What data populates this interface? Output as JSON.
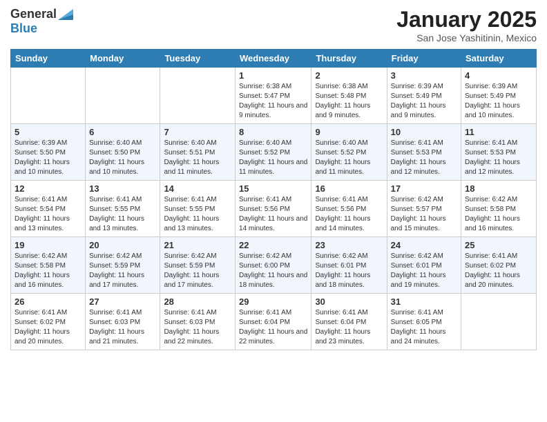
{
  "logo": {
    "line1": "General",
    "line2": "Blue"
  },
  "title": "January 2025",
  "subtitle": "San Jose Yashitinin, Mexico",
  "weekdays": [
    "Sunday",
    "Monday",
    "Tuesday",
    "Wednesday",
    "Thursday",
    "Friday",
    "Saturday"
  ],
  "weeks": [
    [
      {
        "day": "",
        "info": ""
      },
      {
        "day": "",
        "info": ""
      },
      {
        "day": "",
        "info": ""
      },
      {
        "day": "1",
        "info": "Sunrise: 6:38 AM\nSunset: 5:47 PM\nDaylight: 11 hours and 9 minutes."
      },
      {
        "day": "2",
        "info": "Sunrise: 6:38 AM\nSunset: 5:48 PM\nDaylight: 11 hours and 9 minutes."
      },
      {
        "day": "3",
        "info": "Sunrise: 6:39 AM\nSunset: 5:49 PM\nDaylight: 11 hours and 9 minutes."
      },
      {
        "day": "4",
        "info": "Sunrise: 6:39 AM\nSunset: 5:49 PM\nDaylight: 11 hours and 10 minutes."
      }
    ],
    [
      {
        "day": "5",
        "info": "Sunrise: 6:39 AM\nSunset: 5:50 PM\nDaylight: 11 hours and 10 minutes."
      },
      {
        "day": "6",
        "info": "Sunrise: 6:40 AM\nSunset: 5:50 PM\nDaylight: 11 hours and 10 minutes."
      },
      {
        "day": "7",
        "info": "Sunrise: 6:40 AM\nSunset: 5:51 PM\nDaylight: 11 hours and 11 minutes."
      },
      {
        "day": "8",
        "info": "Sunrise: 6:40 AM\nSunset: 5:52 PM\nDaylight: 11 hours and 11 minutes."
      },
      {
        "day": "9",
        "info": "Sunrise: 6:40 AM\nSunset: 5:52 PM\nDaylight: 11 hours and 11 minutes."
      },
      {
        "day": "10",
        "info": "Sunrise: 6:41 AM\nSunset: 5:53 PM\nDaylight: 11 hours and 12 minutes."
      },
      {
        "day": "11",
        "info": "Sunrise: 6:41 AM\nSunset: 5:53 PM\nDaylight: 11 hours and 12 minutes."
      }
    ],
    [
      {
        "day": "12",
        "info": "Sunrise: 6:41 AM\nSunset: 5:54 PM\nDaylight: 11 hours and 13 minutes."
      },
      {
        "day": "13",
        "info": "Sunrise: 6:41 AM\nSunset: 5:55 PM\nDaylight: 11 hours and 13 minutes."
      },
      {
        "day": "14",
        "info": "Sunrise: 6:41 AM\nSunset: 5:55 PM\nDaylight: 11 hours and 13 minutes."
      },
      {
        "day": "15",
        "info": "Sunrise: 6:41 AM\nSunset: 5:56 PM\nDaylight: 11 hours and 14 minutes."
      },
      {
        "day": "16",
        "info": "Sunrise: 6:41 AM\nSunset: 5:56 PM\nDaylight: 11 hours and 14 minutes."
      },
      {
        "day": "17",
        "info": "Sunrise: 6:42 AM\nSunset: 5:57 PM\nDaylight: 11 hours and 15 minutes."
      },
      {
        "day": "18",
        "info": "Sunrise: 6:42 AM\nSunset: 5:58 PM\nDaylight: 11 hours and 16 minutes."
      }
    ],
    [
      {
        "day": "19",
        "info": "Sunrise: 6:42 AM\nSunset: 5:58 PM\nDaylight: 11 hours and 16 minutes."
      },
      {
        "day": "20",
        "info": "Sunrise: 6:42 AM\nSunset: 5:59 PM\nDaylight: 11 hours and 17 minutes."
      },
      {
        "day": "21",
        "info": "Sunrise: 6:42 AM\nSunset: 5:59 PM\nDaylight: 11 hours and 17 minutes."
      },
      {
        "day": "22",
        "info": "Sunrise: 6:42 AM\nSunset: 6:00 PM\nDaylight: 11 hours and 18 minutes."
      },
      {
        "day": "23",
        "info": "Sunrise: 6:42 AM\nSunset: 6:01 PM\nDaylight: 11 hours and 18 minutes."
      },
      {
        "day": "24",
        "info": "Sunrise: 6:42 AM\nSunset: 6:01 PM\nDaylight: 11 hours and 19 minutes."
      },
      {
        "day": "25",
        "info": "Sunrise: 6:41 AM\nSunset: 6:02 PM\nDaylight: 11 hours and 20 minutes."
      }
    ],
    [
      {
        "day": "26",
        "info": "Sunrise: 6:41 AM\nSunset: 6:02 PM\nDaylight: 11 hours and 20 minutes."
      },
      {
        "day": "27",
        "info": "Sunrise: 6:41 AM\nSunset: 6:03 PM\nDaylight: 11 hours and 21 minutes."
      },
      {
        "day": "28",
        "info": "Sunrise: 6:41 AM\nSunset: 6:03 PM\nDaylight: 11 hours and 22 minutes."
      },
      {
        "day": "29",
        "info": "Sunrise: 6:41 AM\nSunset: 6:04 PM\nDaylight: 11 hours and 22 minutes."
      },
      {
        "day": "30",
        "info": "Sunrise: 6:41 AM\nSunset: 6:04 PM\nDaylight: 11 hours and 23 minutes."
      },
      {
        "day": "31",
        "info": "Sunrise: 6:41 AM\nSunset: 6:05 PM\nDaylight: 11 hours and 24 minutes."
      },
      {
        "day": "",
        "info": ""
      }
    ]
  ]
}
